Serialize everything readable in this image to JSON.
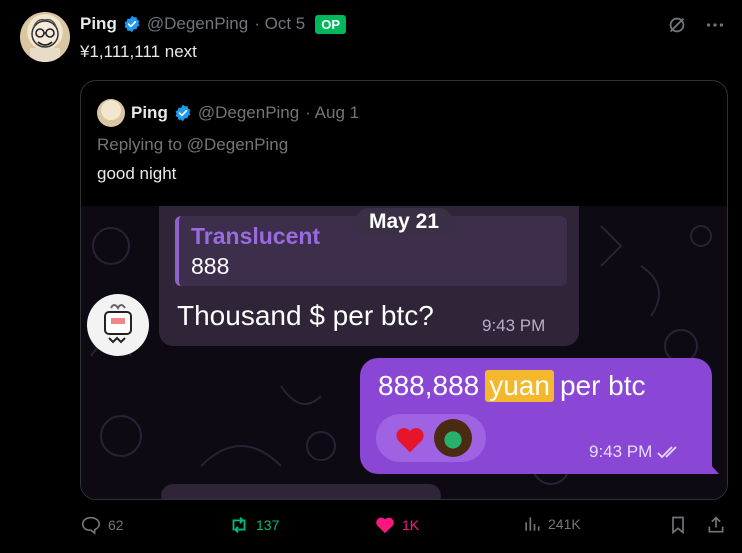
{
  "tweet": {
    "author_name": "Ping",
    "handle": "@DegenPing",
    "date": "· Oct 5",
    "badge": "OP",
    "text": "¥1,111,111 next"
  },
  "quoted_tweet": {
    "author_name": "Ping",
    "handle": "@DegenPing",
    "date": "· Aug 1",
    "replying_to": "Replying to @DegenPing",
    "text": "good night"
  },
  "chat": {
    "date_pill": "May 21",
    "quote_sender": "Translucent",
    "quote_text": "888",
    "incoming_message": "Thousand $ per btc?",
    "incoming_time": "9:43 PM",
    "outgoing_prefix": "888,888",
    "outgoing_highlight": "yuan",
    "outgoing_suffix": "per btc",
    "outgoing_time": "9:43 PM"
  },
  "actions": {
    "replies": "62",
    "reposts": "137",
    "likes": "1K",
    "views": "241K"
  },
  "colors": {
    "accent_blue": "#1d9bf0",
    "op_green": "#00b85c",
    "repost_green": "#00ba7c",
    "like_pink": "#f91880",
    "bubble_purple": "#8a47d6"
  }
}
